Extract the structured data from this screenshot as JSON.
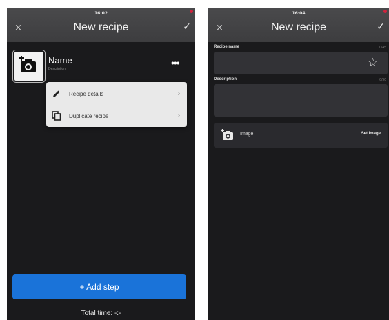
{
  "left": {
    "status_time": "16:02",
    "title": "New recipe",
    "close_icon": "×",
    "check_icon": "✓",
    "recipe_name": "Name",
    "recipe_description": "Description",
    "more_icon": "•••",
    "menu": [
      {
        "label": "Recipe details",
        "icon": "pencil-icon",
        "arrow": "›"
      },
      {
        "label": "Duplicate recipe",
        "icon": "copy-icon",
        "arrow": "›"
      }
    ],
    "add_step_label": "+ Add step",
    "total_time": "Total time: -:-"
  },
  "right": {
    "status_time": "16:04",
    "title": "New recipe",
    "close_icon": "×",
    "check_icon": "✓",
    "recipe_name_label": "Recipe name",
    "recipe_name_counter": "0/45",
    "star_icon": "☆",
    "description_label": "Description",
    "description_counter": "0/90",
    "image_label": "Image",
    "set_image_label": "Set image"
  },
  "colors": {
    "background": "#1a1a1c",
    "toolbar": "#434345",
    "accent": "#1a73d9",
    "status_dot": "#d0233e",
    "menu_bg": "#e9e9e9"
  }
}
